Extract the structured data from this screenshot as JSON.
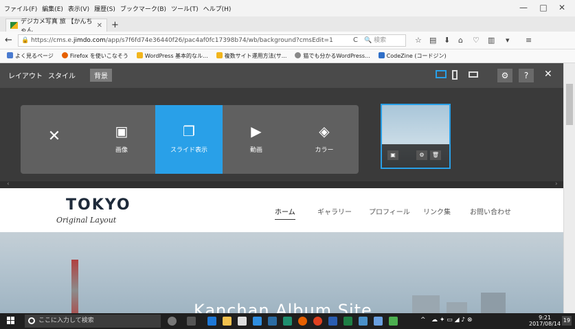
{
  "menubar": {
    "items": [
      "ファイル(F)",
      "編集(E)",
      "表示(V)",
      "履歴(S)",
      "ブックマーク(B)",
      "ツール(T)",
      "ヘルプ(H)"
    ],
    "minimize": "—",
    "maximize": "□",
    "close": "✕"
  },
  "tab": {
    "title": "デジカメ写真 旅 【かんちゃん",
    "close": "✕",
    "newtab": "+"
  },
  "nav": {
    "url_prefix": "https://cms.e.",
    "url_domain": "jimdo.com",
    "url_rest": "/app/s7f6fd74e36440f26/pac4af0fc17398b74/wb/background?cmsEdit=1",
    "search_placeholder": "検索",
    "back": "←",
    "reload": "C",
    "menu": "≡"
  },
  "bookmarks": [
    {
      "label": "よく見るページ",
      "color": "#4a7bd0"
    },
    {
      "label": "Firefox を使いこなそう",
      "color": "#e66000"
    },
    {
      "label": "WordPress 基本的なル...",
      "color": "#f2b51c"
    },
    {
      "label": "複数サイト運用方法(サ...",
      "color": "#f2b51c"
    },
    {
      "label": "猫でも分かるWordPress...",
      "color": "#888888"
    },
    {
      "label": "CodeZine (コードジン)",
      "color": "#2f6fc8"
    }
  ],
  "editor": {
    "tabs": [
      "レイアウト",
      "スタイル",
      "背景"
    ],
    "active_tab": "背景",
    "settings_icon": "⚙",
    "help_label": "?",
    "close_label": "✕",
    "options": [
      {
        "icon": "✕",
        "label": ""
      },
      {
        "icon": "▣",
        "label": "画像"
      },
      {
        "icon": "❐",
        "label": "スライド表示"
      },
      {
        "icon": "▶",
        "label": "動画"
      },
      {
        "icon": "◈",
        "label": "カラー"
      }
    ],
    "selected_option": "スライド表示"
  },
  "site": {
    "logo_main": "TOKYO",
    "logo_sub": "Original Layout",
    "nav": [
      "ホーム",
      "ギャラリー",
      "プロフィール",
      "リンク集",
      "お問い合わせ"
    ],
    "active_nav": "ホーム",
    "hero_title": "Kanchan Album Site"
  },
  "taskbar": {
    "search_placeholder": "ここに入力して検索",
    "time": "9:21",
    "date": "2017/08/14",
    "notification_count": "19"
  },
  "colors": {
    "accent": "#29a0e8",
    "editor_bg": "#4a4a4a",
    "panel_bg": "#3a3a3a"
  }
}
